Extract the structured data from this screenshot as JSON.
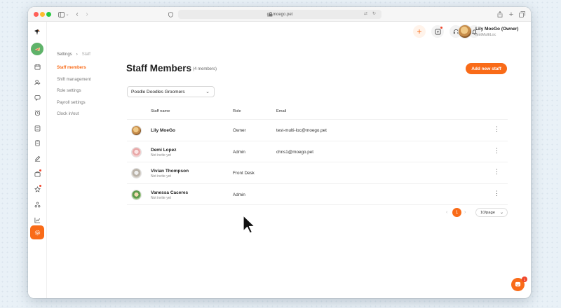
{
  "browser": {
    "url": "go.moego.pet"
  },
  "topbar": {
    "user_name": "Lily MoeGo (Owner)",
    "user_sub": "testMultiLoc"
  },
  "breadcrumb": {
    "root": "Settings",
    "separator": "›",
    "current": "Staff"
  },
  "settings_nav": [
    {
      "label": "Staff members",
      "active": true
    },
    {
      "label": "Shift management",
      "active": false
    },
    {
      "label": "Role settings",
      "active": false
    },
    {
      "label": "Payroll settings",
      "active": false
    },
    {
      "label": "Clock in/out",
      "active": false
    }
  ],
  "page": {
    "title": "Staff Members",
    "count": "(4 members)",
    "add_button": "Add new staff",
    "location_select": "Poodle Doodles Groomers"
  },
  "table": {
    "headers": {
      "name": "Staff name",
      "role": "Role",
      "email": "Email"
    },
    "rows": [
      {
        "name": "Lily MoeGo",
        "status": "",
        "role": "Owner",
        "email": "test-multi-loc@moego.pet"
      },
      {
        "name": "Demi Lopez",
        "status": "Not invite yet",
        "role": "Admin",
        "email": "chns1@moego.pet"
      },
      {
        "name": "Vivian Thompson",
        "status": "Not invite yet",
        "role": "Front Desk",
        "email": ""
      },
      {
        "name": "Vanessa Caceres",
        "status": "Not invite yet",
        "role": "Admin",
        "email": ""
      }
    ],
    "more_glyph": "⋮"
  },
  "pagination": {
    "prev": "‹",
    "current_page": "1",
    "next": "›",
    "page_size": "10/page"
  },
  "chat": {
    "badge": "1"
  },
  "colors": {
    "accent": "#f96b18",
    "badge": "#f0472c"
  }
}
